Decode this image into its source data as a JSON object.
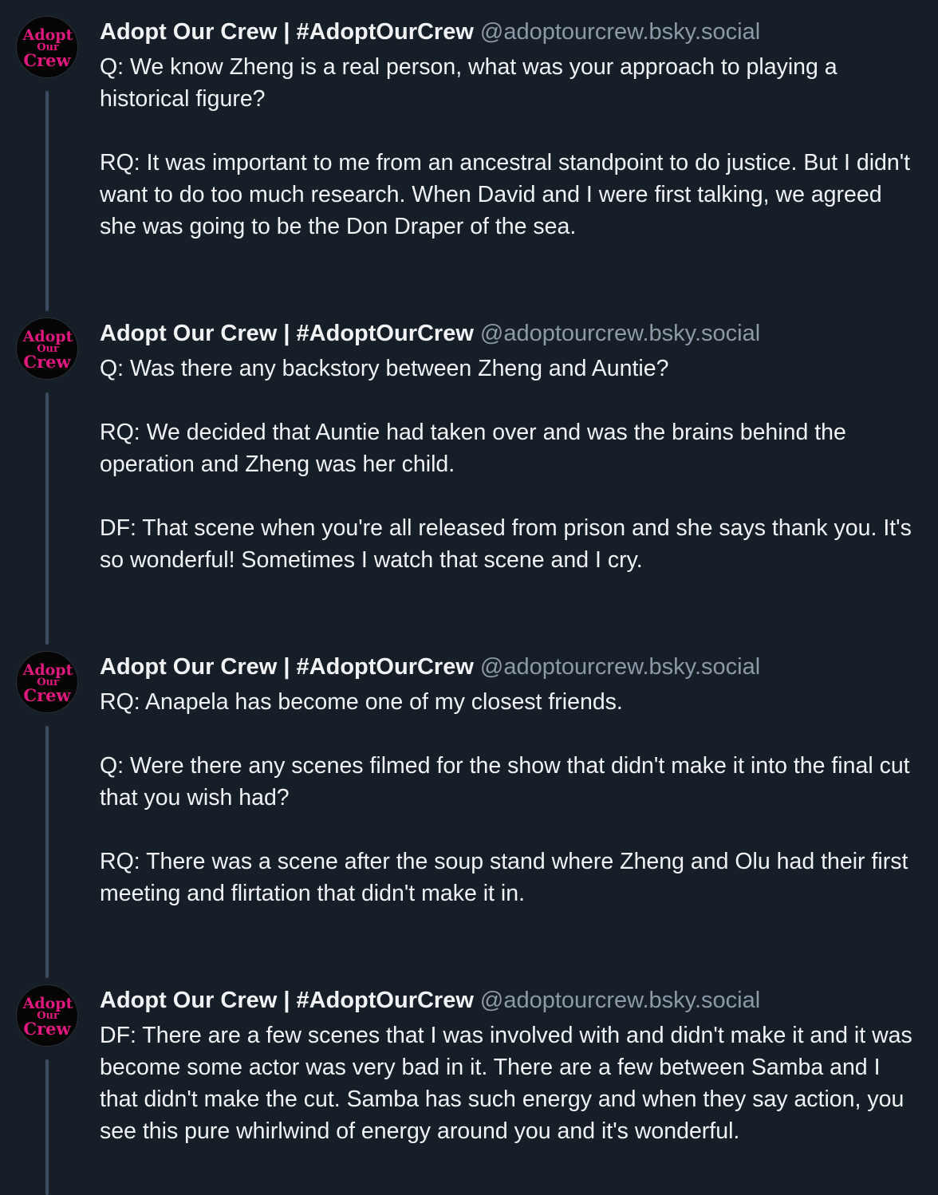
{
  "posts": [
    {
      "display_name": "Adopt Our Crew | #AdoptOurCrew",
      "handle": "@adoptourcrew.bsky.social",
      "avatar_text": [
        "Adopt",
        "Our",
        "Crew"
      ],
      "avatar_icon": "gothic-logo-avatar",
      "paragraphs": [
        "Q: We know Zheng is a real person, what was your approach to playing a historical figure?",
        "RQ: It was important to me from an ancestral standpoint to do justice. But I didn't want to do too much research. When David and I were first talking, we agreed she was going to be the Don Draper of the sea."
      ]
    },
    {
      "display_name": "Adopt Our Crew | #AdoptOurCrew",
      "handle": "@adoptourcrew.bsky.social",
      "avatar_text": [
        "Adopt",
        "Our",
        "Crew"
      ],
      "avatar_icon": "gothic-logo-avatar",
      "paragraphs": [
        "Q: Was there any backstory between Zheng and Auntie?",
        "RQ: We decided that Auntie had taken over and was the brains behind the operation and Zheng was her child.",
        "DF: That scene when you're all released from prison and she says thank you. It's so wonderful! Sometimes I watch that scene and I cry."
      ]
    },
    {
      "display_name": "Adopt Our Crew | #AdoptOurCrew",
      "handle": "@adoptourcrew.bsky.social",
      "avatar_text": [
        "Adopt",
        "Our",
        "Crew"
      ],
      "avatar_icon": "gothic-logo-avatar",
      "paragraphs": [
        "RQ: Anapela has become one of my closest friends.",
        "Q: Were there any scenes filmed for the show that didn't make it into the final cut that you wish had?",
        "RQ: There was a scene after the soup stand where Zheng and Olu had their first meeting and flirtation that didn't make it in."
      ]
    },
    {
      "display_name": "Adopt Our Crew | #AdoptOurCrew",
      "handle": "@adoptourcrew.bsky.social",
      "avatar_text": [
        "Adopt",
        "Our",
        "Crew"
      ],
      "avatar_icon": "gothic-logo-avatar",
      "paragraphs": [
        "DF: There are a few scenes that I was involved with and didn't make it and it was become some actor was very bad in it. There are a few between Samba and I that didn't make the cut. Samba has such energy and when they say action, you see this pure whirlwind of energy around you and it's wonderful."
      ]
    }
  ],
  "colors": {
    "background": "#161e27",
    "text": "#f1f3f5",
    "handle": "#8d99a8",
    "thread_line": "#3d4d61",
    "avatar_logo": "#e0197f"
  }
}
